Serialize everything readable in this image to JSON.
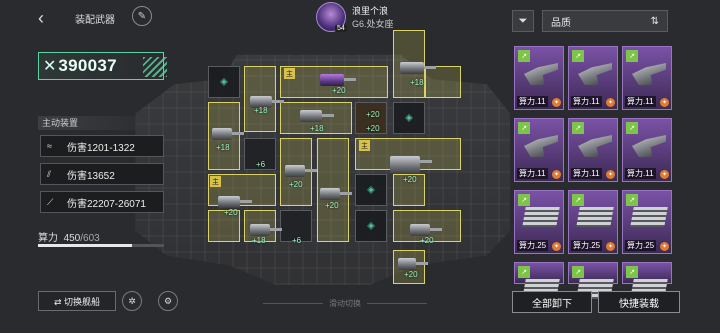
{
  "header": {
    "back_icon": "‹",
    "title": "装配武器",
    "edit_icon": "✎"
  },
  "player": {
    "name": "浪里个浪",
    "level": "54",
    "server": "G6.处女座"
  },
  "filter": {
    "icon": "⏷",
    "sort_label": "品质",
    "sort_icon": "⇅"
  },
  "power": {
    "icon": "✕",
    "value": "390037"
  },
  "active_device": {
    "label": "主动装置",
    "stats": [
      {
        "icon": "≈",
        "text": "伤害1201-1322"
      },
      {
        "icon": "⫽",
        "text": "伤害13652"
      },
      {
        "icon": "⟋",
        "text": "伤害22207-26071"
      }
    ]
  },
  "capacity": {
    "label": "算力",
    "used": "450",
    "max": "/603",
    "fraction": 0.746
  },
  "bottom": {
    "switch_ship": "⇄ 切换舰船",
    "swipe_hint": "滑动切换",
    "unload_all": "全部卸下",
    "quick_equip": "快捷装载"
  },
  "grid": {
    "main_tag": "主",
    "bonuses": [
      "+20",
      "+18",
      "+18",
      "+18",
      "+18",
      "+6",
      "+20",
      "+20",
      "+20",
      "+20",
      "+20",
      "+18",
      "+6",
      "+20",
      "+20",
      "+20"
    ]
  },
  "inventory": [
    {
      "label": "算力.11",
      "rarity": "purple"
    },
    {
      "label": "算力.11",
      "rarity": "purple"
    },
    {
      "label": "算力.11",
      "rarity": "purple"
    },
    {
      "label": "算力.11",
      "rarity": "purple"
    },
    {
      "label": "算力.11",
      "rarity": "purple"
    },
    {
      "label": "算力.11",
      "rarity": "purple"
    },
    {
      "label": "算力.25",
      "rarity": "purple"
    },
    {
      "label": "算力.25",
      "rarity": "purple"
    },
    {
      "label": "算力.25",
      "rarity": "purple"
    },
    {
      "label": "",
      "rarity": "purple"
    },
    {
      "label": "",
      "rarity": "purple"
    },
    {
      "label": "",
      "rarity": "purple"
    }
  ]
}
